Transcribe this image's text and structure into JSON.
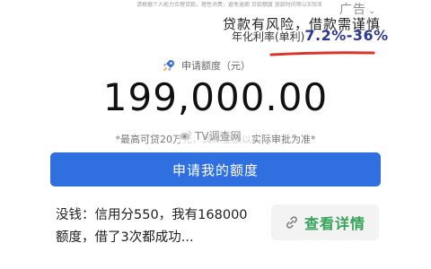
{
  "ad": {
    "disclaimer": "请根据个人能力合理贷款，理性消费，避免逾期 贷款额度 放款时间等以实际审批为准",
    "tag": "广告"
  },
  "risk_notice": "贷款有风险，借款需谨慎",
  "rate": {
    "label": "年化利率(单利)",
    "value": "7.2%-36%"
  },
  "amount_section": {
    "label": "申请额度（元）",
    "amount": "199,000.00",
    "note": "*最高可贷20万元，具体金额以实际审批为准*"
  },
  "watermark": "TV调查网",
  "apply_button": "申请我的额度",
  "testimonial": "没钱：信用分550，我有168000额度，借了3次都成功...",
  "detail_button": "查看详情",
  "colors": {
    "button_blue": "#2f6fe0",
    "detail_green": "#35a35a",
    "underline_red": "#d9352b",
    "rate_blue": "#2d3a8c"
  }
}
